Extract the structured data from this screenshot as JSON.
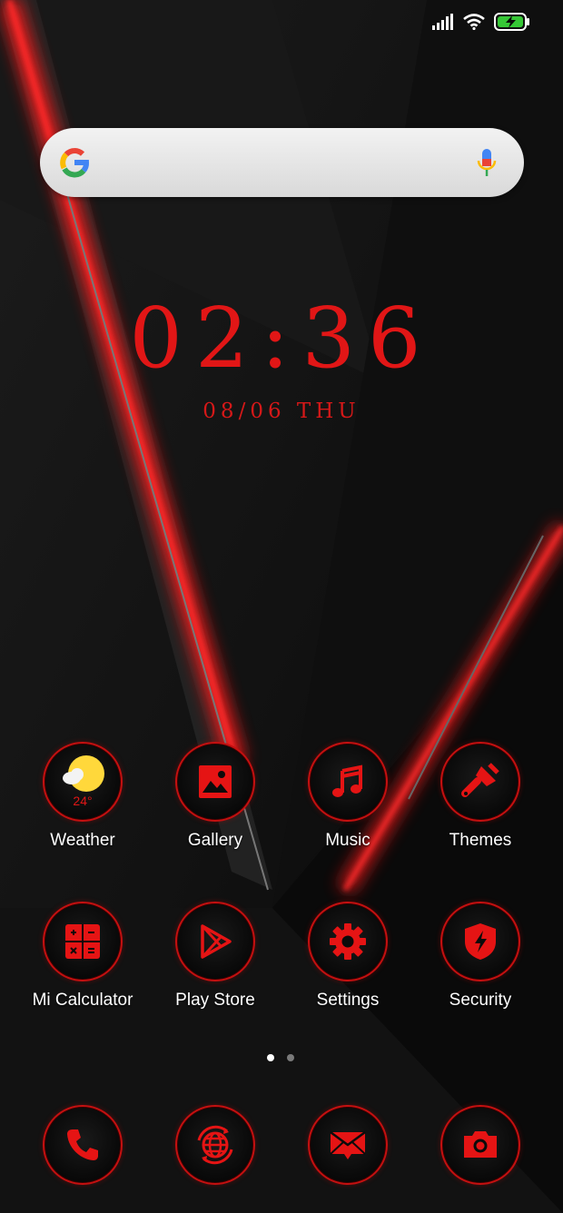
{
  "status_bar": {
    "icons": [
      "signal-icon",
      "wifi-icon",
      "battery-charging-icon"
    ]
  },
  "search": {
    "logo": "google-g-icon",
    "mic": "mic-icon"
  },
  "clock": {
    "time": "02:36",
    "date": "08/06 THU"
  },
  "weather": {
    "temperature": "24°"
  },
  "apps": [
    {
      "label": "Weather",
      "icon": "weather-icon"
    },
    {
      "label": "Gallery",
      "icon": "gallery-icon"
    },
    {
      "label": "Music",
      "icon": "music-icon"
    },
    {
      "label": "Themes",
      "icon": "paintbrush-icon"
    },
    {
      "label": "Mi Calculator",
      "icon": "calculator-icon"
    },
    {
      "label": "Play Store",
      "icon": "play-store-icon"
    },
    {
      "label": "Settings",
      "icon": "gear-icon"
    },
    {
      "label": "Security",
      "icon": "shield-icon"
    }
  ],
  "dock": [
    {
      "icon": "phone-icon"
    },
    {
      "icon": "browser-icon"
    },
    {
      "icon": "messages-icon"
    },
    {
      "icon": "camera-icon"
    }
  ],
  "pager": {
    "pages": 2,
    "current": 1
  },
  "colors": {
    "accent": "#e11616",
    "background": "#0b0b0b"
  }
}
